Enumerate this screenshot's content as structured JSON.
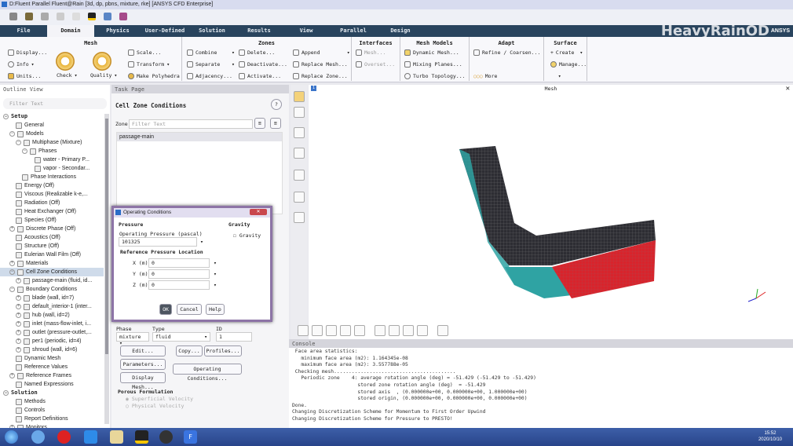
{
  "window": {
    "title": "D:Fluent Parallel Fluent@Rain  [3d, dp, pbns, mixture, rke] [ANSYS CFD Enterprise]"
  },
  "watermark": "HeavyRainOD",
  "brand": "ANSYS",
  "tabs": [
    "File",
    "Domain",
    "Physics",
    "User-Defined",
    "Solution",
    "Results",
    "View",
    "Parallel",
    "Design"
  ],
  "ribbon": {
    "mesh": {
      "title": "Mesh",
      "display": "Display...",
      "info": "Info",
      "units": "Units...",
      "check": "Check",
      "quality": "Quality",
      "scale": "Scale...",
      "transform": "Transform",
      "polyhedra": "Make Polyhedra"
    },
    "zones": {
      "title": "Zones",
      "combine": "Combine",
      "separate": "Separate",
      "adjacency": "Adjacency...",
      "delete": "Delete...",
      "deactivate": "Deactivate...",
      "activate": "Activate...",
      "append": "Append",
      "replace_mesh": "Replace Mesh...",
      "replace_zone": "Replace Zone..."
    },
    "interfaces": {
      "title": "Interfaces",
      "mesh": "Mesh...",
      "overset": "Overset..."
    },
    "mesh_models": {
      "title": "Mesh Models",
      "dynamic": "Dynamic Mesh...",
      "mixing": "Mixing Planes...",
      "turbo": "Turbo Topology..."
    },
    "adapt": {
      "title": "Adapt",
      "refine": "Refine / Coarsen...",
      "more": "More"
    },
    "surface": {
      "title": "Surface",
      "create": "Create",
      "manage": "Manage..."
    }
  },
  "outline": {
    "title": "Outline View",
    "filter_placeholder": "Filter Text",
    "items": [
      {
        "label": "Setup",
        "level": 0,
        "tog": "-",
        "hdr": true
      },
      {
        "label": "General",
        "level": 2
      },
      {
        "label": "Models",
        "level": 1,
        "tog": "-"
      },
      {
        "label": "Multiphase (Mixture)",
        "level": 2,
        "tog": "-"
      },
      {
        "label": "Phases",
        "level": 3,
        "tog": "-"
      },
      {
        "label": "water - Primary P...",
        "level": 5
      },
      {
        "label": "vapor - Secondar...",
        "level": 5
      },
      {
        "label": "Phase Interactions",
        "level": 3
      },
      {
        "label": "Energy (Off)",
        "level": 2
      },
      {
        "label": "Viscous (Realizable k-e,...",
        "level": 2
      },
      {
        "label": "Radiation (Off)",
        "level": 2
      },
      {
        "label": "Heat Exchanger (Off)",
        "level": 2
      },
      {
        "label": "Species (Off)",
        "level": 2
      },
      {
        "label": "Discrete Phase (Off)",
        "level": 1,
        "tog": "+"
      },
      {
        "label": "Acoustics (Off)",
        "level": 2
      },
      {
        "label": "Structure (Off)",
        "level": 2
      },
      {
        "label": "Eulerian Wall Film (Off)",
        "level": 2
      },
      {
        "label": "Materials",
        "level": 1,
        "tog": "+"
      },
      {
        "label": "Cell Zone Conditions",
        "level": 1,
        "tog": "-",
        "sel": true
      },
      {
        "label": "passage-main (fluid, id...",
        "level": 2,
        "tog": "+"
      },
      {
        "label": "Boundary Conditions",
        "level": 1,
        "tog": "-"
      },
      {
        "label": "blade (wall, id=7)",
        "level": 2,
        "tog": "+"
      },
      {
        "label": "default_interior-1 (inter...",
        "level": 2,
        "tog": "+"
      },
      {
        "label": "hub (wall, id=2)",
        "level": 2,
        "tog": "+"
      },
      {
        "label": "inlet (mass-flow-inlet, i...",
        "level": 2,
        "tog": "+"
      },
      {
        "label": "outlet (pressure-outlet,...",
        "level": 2,
        "tog": "+"
      },
      {
        "label": "per1 (periodic, id=4)",
        "level": 2,
        "tog": "+"
      },
      {
        "label": "shroud (wall, id=6)",
        "level": 2,
        "tog": "+"
      },
      {
        "label": "Dynamic Mesh",
        "level": 2
      },
      {
        "label": "Reference Values",
        "level": 2
      },
      {
        "label": "Reference Frames",
        "level": 1,
        "tog": "+"
      },
      {
        "label": "Named Expressions",
        "level": 2
      },
      {
        "label": "Solution",
        "level": 0,
        "tog": "-",
        "hdr": true
      },
      {
        "label": "Methods",
        "level": 2
      },
      {
        "label": "Controls",
        "level": 2
      },
      {
        "label": "Report Definitions",
        "level": 2
      },
      {
        "label": "Monitors",
        "level": 1,
        "tog": "+"
      }
    ]
  },
  "task": {
    "title": "Task Page",
    "heading": "Cell Zone Conditions",
    "zone_label": "Zone",
    "zone_placeholder": "Filter Text",
    "zones": [
      "passage-main"
    ],
    "phase_label": "Phase",
    "phase_value": "mixture",
    "type_label": "Type",
    "type_value": "fluid",
    "id_label": "ID",
    "id_value": "1",
    "edit": "Edit...",
    "copy": "Copy...",
    "profiles": "Profiles...",
    "parameters": "Parameters...",
    "operating": "Operating Conditions...",
    "display_mesh": "Display Mesh...",
    "porous_title": "Porous Formulation",
    "superficial": "Superficial Velocity",
    "physical": "Physical Velocity"
  },
  "dialog": {
    "title": "Operating Conditions",
    "pressure_section": "Pressure",
    "op_pressure_label": "Operating Pressure (pascal)",
    "op_pressure": "101325",
    "ref_loc": "Reference Pressure Location",
    "x_label": "X (m)",
    "x": "0",
    "y_label": "Y (m)",
    "y": "0",
    "z_label": "Z (m)",
    "z": "0",
    "gravity_section": "Gravity",
    "gravity_check": "Gravity",
    "ok": "OK",
    "cancel": "Cancel",
    "help": "Help"
  },
  "graphics": {
    "title": "Mesh",
    "tab": "1"
  },
  "console": {
    "title": "Console",
    "text": " Face area statistics:\n   minimum face area (m2): 1.164345e-08\n   maximum face area (m2): 3.557788e-05\n Checking mesh.........................................\n   Periodic zone    4: average rotation angle (deg) = -51.429 (-51.429 to -51.429)\n                      stored zone rotation angle (deg)  = -51.429\n                      stored axis  , (0.000000e+00, 0.000000e+00, 1.000000e+00)\n                      stored origin, (0.000000e+00, 0.000000e+00, 0.000000e+00)\nDone.\nChanging Discretization Scheme for Momentum to First Order Upwind\nChanging Discretization Scheme for Pressure to PRESTO!"
  },
  "taskbar": {
    "time": "15:52",
    "date": "2020/10/10"
  },
  "colors": {
    "tab_bar": "#29445e",
    "mesh_red": "#d8242c",
    "mesh_teal": "#2fa3a3"
  }
}
